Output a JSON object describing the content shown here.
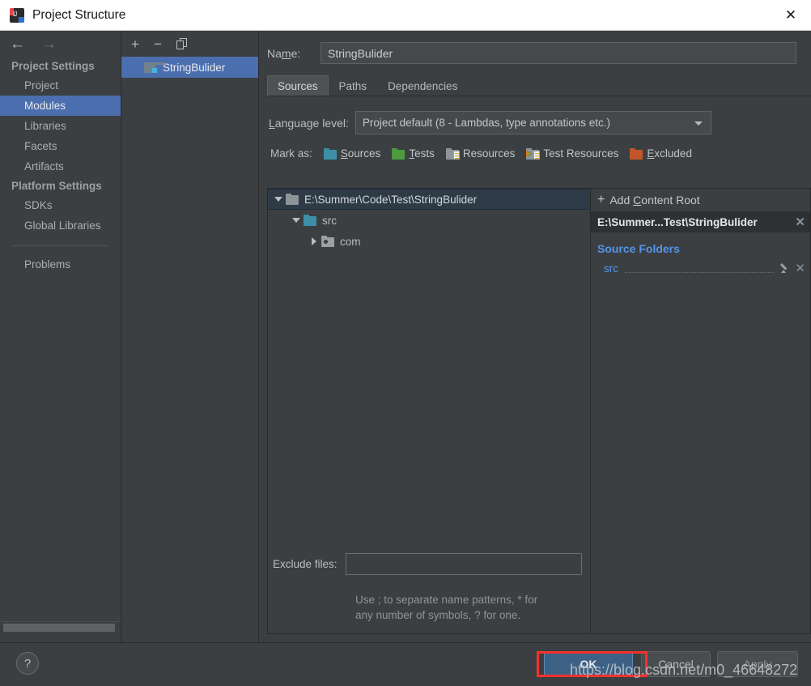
{
  "window": {
    "title": "Project Structure",
    "app_icon": "intellij-idea-icon",
    "close_label": "✕"
  },
  "sidebar": {
    "back_arrow": "←",
    "forward_arrow": "→",
    "groups": [
      {
        "title": "Project Settings",
        "items": [
          {
            "label": "Project",
            "selected": false
          },
          {
            "label": "Modules",
            "selected": true
          },
          {
            "label": "Libraries",
            "selected": false
          },
          {
            "label": "Facets",
            "selected": false
          },
          {
            "label": "Artifacts",
            "selected": false
          }
        ]
      },
      {
        "title": "Platform Settings",
        "items": [
          {
            "label": "SDKs",
            "selected": false
          },
          {
            "label": "Global Libraries",
            "selected": false
          }
        ]
      }
    ],
    "problems_label": "Problems"
  },
  "modules_panel": {
    "toolbar": {
      "add_label": "+",
      "remove_label": "−",
      "copy_label": "copy-icon"
    },
    "modules": [
      {
        "label": "StringBulider",
        "selected": true
      }
    ]
  },
  "main": {
    "name": {
      "label_pre": "Na",
      "label_mnemonic": "m",
      "label_post": "e:",
      "value": "StringBulider",
      "placeholder": ""
    },
    "tabs": [
      {
        "label": "Sources",
        "active": true
      },
      {
        "label": "Paths",
        "active": false
      },
      {
        "label": "Dependencies",
        "active": false
      }
    ],
    "language_level": {
      "label_mnemonic": "L",
      "label_rest": "anguage level:",
      "value": "Project default (8 - Lambdas, type annotations etc.)",
      "options": [
        "Project default (8 - Lambdas, type annotations etc.)"
      ]
    },
    "mark_as": {
      "label": "Mark as:",
      "items": [
        {
          "mnemonic": "S",
          "rest": "ources",
          "icon": "sources-folder-icon",
          "color": "#3d8fa8"
        },
        {
          "mnemonic": "T",
          "rest": "ests",
          "icon": "tests-folder-icon",
          "color": "#4d9a3f"
        },
        {
          "mnemonic": "R",
          "rest": "esources",
          "icon": "resources-folder-icon",
          "color": "#8d9499"
        },
        {
          "mnemonic": "",
          "rest": "Test Resources",
          "icon": "test-resources-folder-icon",
          "color": "#8d9499"
        },
        {
          "mnemonic": "E",
          "rest": "xcluded",
          "icon": "excluded-folder-icon",
          "color": "#c2562a"
        }
      ]
    },
    "tree": [
      {
        "label": "E:\\Summer\\Code\\Test\\StringBulider",
        "indent": 0,
        "twisty": "down",
        "icon": "content-root-folder-icon",
        "icon_color": "#8d9499",
        "selected": true
      },
      {
        "label": "src",
        "indent": 1,
        "twisty": "down",
        "icon": "source-folder-icon",
        "icon_color": "#3d8fa8",
        "selected": false
      },
      {
        "label": "com",
        "indent": 2,
        "twisty": "right",
        "icon": "package-folder-icon",
        "icon_color": "#9aa0a4",
        "selected": false
      }
    ],
    "exclude_files": {
      "label": "Exclude files:",
      "value": "",
      "placeholder": "",
      "hint_line1": "Use ; to separate name patterns, * for",
      "hint_line2": "any number of symbols, ? for one."
    },
    "right_panel": {
      "add_content_root_pre": "Add ",
      "add_content_root_mnemonic": "C",
      "add_content_root_post": "ontent Root",
      "plus": "+",
      "content_root": {
        "label": "E:\\Summer...Test\\StringBulider",
        "close": "✕"
      },
      "source_folders_title": "Source Folders",
      "source_folders": [
        {
          "name": "src",
          "edit": "pencil-icon",
          "remove": "✕"
        }
      ]
    }
  },
  "footer": {
    "help_label": "?",
    "ok_label": "OK",
    "cancel_label": "Cancel",
    "apply_label": "Apply"
  },
  "annotation": {
    "highlight_color": "#f1322e",
    "watermark": "https://blog.csdn.net/m0_46648272"
  }
}
